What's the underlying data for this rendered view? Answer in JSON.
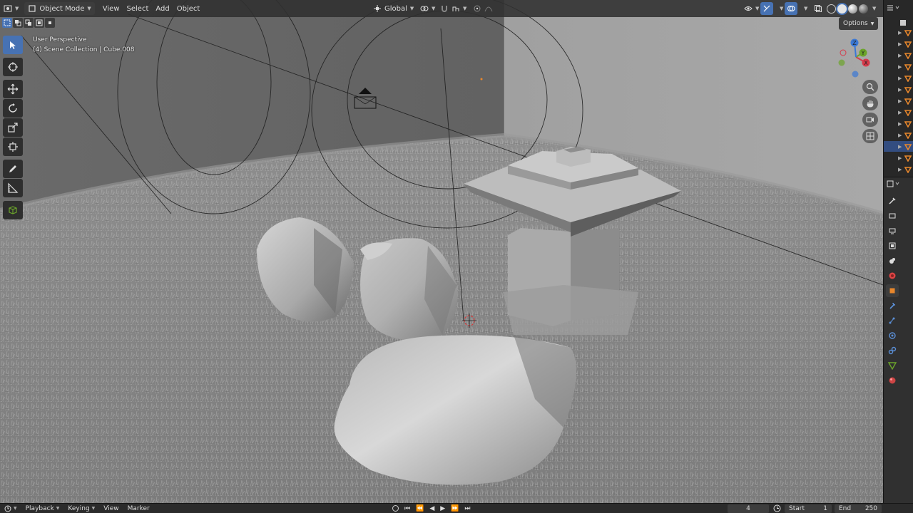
{
  "header": {
    "mode_label": "Object Mode",
    "menu": [
      "View",
      "Select",
      "Add",
      "Object"
    ],
    "orientation_label": "Global",
    "options_label": "Options"
  },
  "overlay": {
    "perspective": "User Perspective",
    "collection_info": "(4) Scene Collection | Cube.008"
  },
  "gizmo": {
    "x": "X",
    "y": "Y",
    "z": "Z"
  },
  "toolbar": {
    "tools": [
      "select-box",
      "cursor",
      "move",
      "rotate",
      "scale",
      "transform",
      "annotate",
      "measure",
      "add-cube"
    ],
    "active": "select-box"
  },
  "timeline": {
    "menu": [
      "Playback",
      "Keying",
      "View",
      "Marker"
    ],
    "current_frame": "4",
    "start_label": "Start",
    "start_value": "1",
    "end_label": "End",
    "end_value": "250"
  },
  "colors": {
    "accent": "#4772b3",
    "object_orange": "#e8872c",
    "axis_x": "#d63a4a",
    "axis_y": "#6ba42a",
    "axis_z": "#3a78d6"
  }
}
